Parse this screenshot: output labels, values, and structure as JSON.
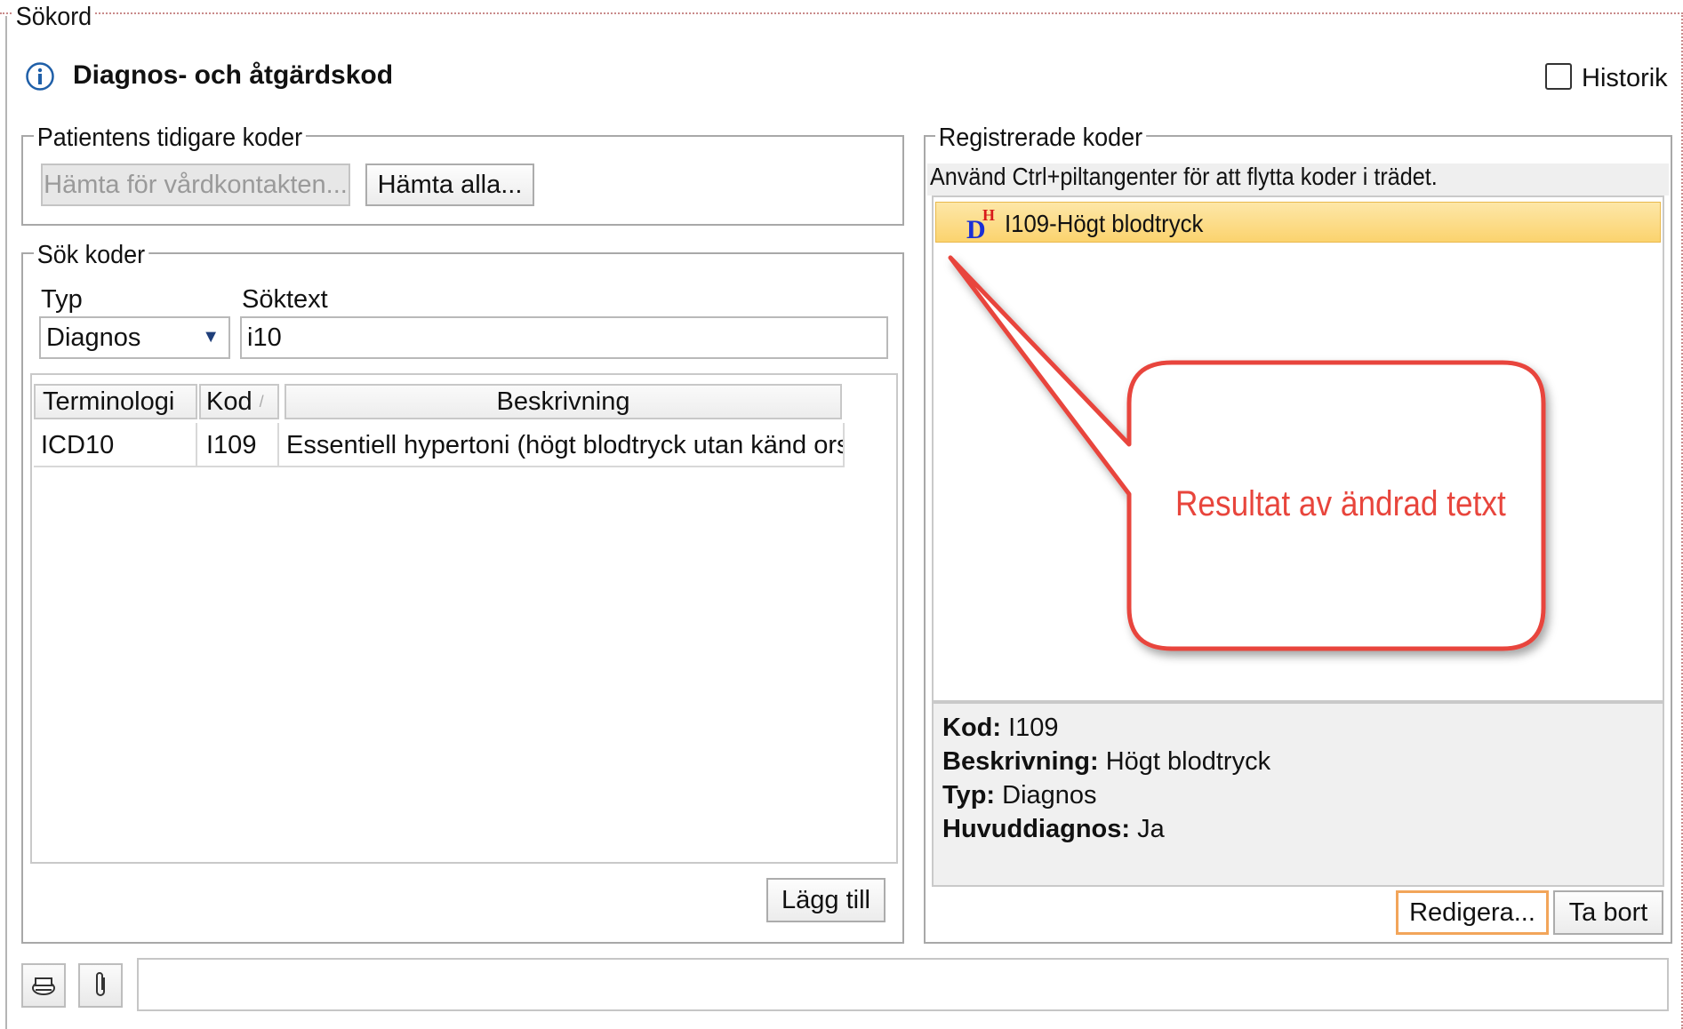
{
  "frame": {
    "legend": "Sökord"
  },
  "header": {
    "title": "Diagnos- och åtgärdskod",
    "history_label": "Historik",
    "history_checked": false
  },
  "previous_codes": {
    "legend": "Patientens tidigare koder",
    "fetch_contact_label": "Hämta för vårdkontakten...",
    "fetch_all_label": "Hämta alla..."
  },
  "search": {
    "legend": "Sök koder",
    "type_label": "Typ",
    "type_value": "Diagnos",
    "text_label": "Söktext",
    "text_value": "i10",
    "columns": [
      "Terminologi",
      "Kod",
      "Beskrivning"
    ],
    "sort_indicator": "/",
    "rows": [
      {
        "terminology": "ICD10",
        "code": "I109",
        "description": "Essentiell hypertoni (högt blodtryck utan känd orsak)"
      }
    ],
    "add_label": "Lägg till"
  },
  "registered": {
    "legend": "Registrerade koder",
    "hint": "Använd Ctrl+piltangenter för att flytta koder i trädet.",
    "tree_items": [
      {
        "badge_main": "D",
        "badge_sup": "H",
        "label": "I109-Högt blodtryck",
        "selected": true
      }
    ],
    "details": {
      "code_key": "Kod:",
      "code_val": "I109",
      "desc_key": "Beskrivning:",
      "desc_val": "Högt blodtryck",
      "type_key": "Typ:",
      "type_val": "Diagnos",
      "main_key": "Huvuddiagnos:",
      "main_val": "Ja"
    },
    "edit_label": "Redigera...",
    "remove_label": "Ta bort"
  },
  "callout": {
    "text": "Resultat av ändrad tetxt",
    "color": "#e8453c"
  },
  "icons": [
    "info-icon",
    "printer-icon",
    "attachment-icon",
    "dropdown-arrow-icon"
  ]
}
